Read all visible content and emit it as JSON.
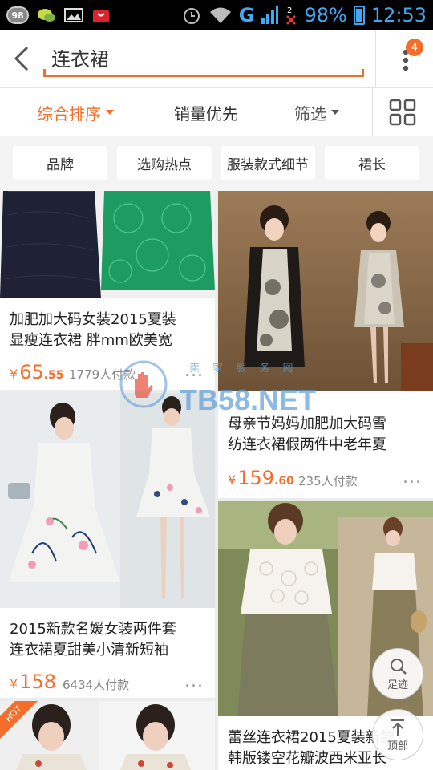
{
  "status_bar": {
    "bubble": "98",
    "network": "G",
    "battery": "98%",
    "time": "12:53"
  },
  "header": {
    "search_value": "连衣裙",
    "menu_badge": "4"
  },
  "sort_bar": {
    "items": [
      {
        "label": "综合排序",
        "active": true,
        "has_caret": true
      },
      {
        "label": "销量优先",
        "active": false,
        "has_caret": false
      },
      {
        "label": "筛选",
        "active": false,
        "has_caret": true
      }
    ]
  },
  "filter_chips": [
    "品牌",
    "选购热点",
    "服装款式细节",
    "裙长"
  ],
  "products": [
    {
      "title_lines": [
        "加肥加大码女装2015夏装",
        "显瘦连衣裙 胖mm欧美宽"
      ],
      "price_int": "65",
      "price_dec": ".55",
      "paid": "1779人付款"
    },
    {
      "title_lines": [
        "母亲节妈妈加肥加大码雪",
        "纺连衣裙假两件中老年夏"
      ],
      "price_int": "159",
      "price_dec": ".60",
      "paid": "235人付款"
    },
    {
      "title_lines": [
        "2015新款名媛女装两件套",
        "连衣裙夏甜美小清新短袖"
      ],
      "price_int": "158",
      "price_dec": "",
      "paid": "6434人付款"
    },
    {
      "title_lines": [
        "蕾丝连衣裙2015夏装新款",
        "韩版镂空花瓣波西米亚长"
      ],
      "price_int": "",
      "price_dec": "",
      "paid": ""
    }
  ],
  "currency_symbol": "¥",
  "more_dots": "...",
  "hot_tag": "HOT",
  "watermark": {
    "text": "TB58.NET",
    "sub": "卖 家 服 务 网"
  },
  "float_buttons": {
    "footprint": "足迹",
    "top": "顶部"
  },
  "colors": {
    "accent": "#f56d28"
  }
}
